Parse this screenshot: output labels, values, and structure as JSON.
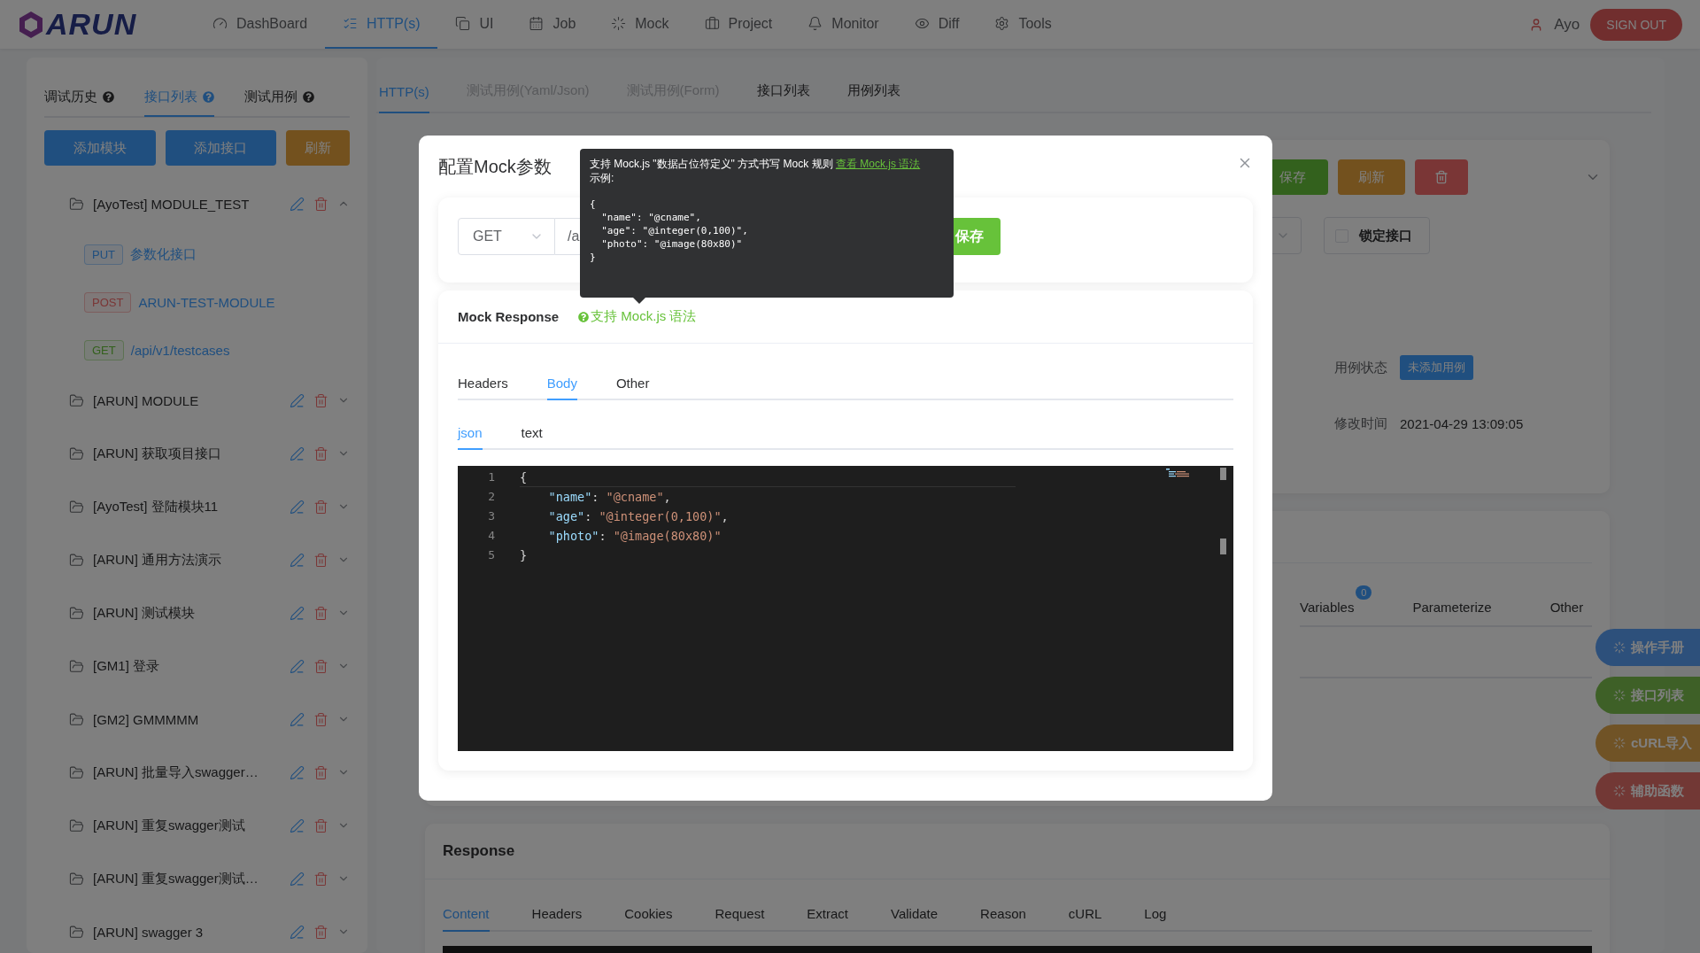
{
  "nav": {
    "logo": "ARUN",
    "items": [
      {
        "label": "DashBoard",
        "selected": false
      },
      {
        "label": "HTTP(s)",
        "selected": true
      },
      {
        "label": "UI",
        "selected": false
      },
      {
        "label": "Job",
        "selected": false
      },
      {
        "label": "Mock",
        "selected": false
      },
      {
        "label": "Project",
        "selected": false
      },
      {
        "label": "Monitor",
        "selected": false
      },
      {
        "label": "Diff",
        "selected": false
      },
      {
        "label": "Tools",
        "selected": false
      }
    ],
    "user": "Ayo",
    "sign_out": "SIGN OUT"
  },
  "sidebar": {
    "tabs": [
      {
        "label": "调试历史",
        "selected": false,
        "help": true
      },
      {
        "label": "接口列表",
        "selected": true,
        "help": true
      },
      {
        "label": "测试用例",
        "selected": false,
        "help": true
      }
    ],
    "buttons": [
      {
        "label": "添加模块",
        "kind": "primary"
      },
      {
        "label": "添加接口",
        "kind": "primary"
      },
      {
        "label": "刷新",
        "kind": "warning"
      }
    ],
    "modules": [
      {
        "name": "[AyoTest] MODULE_TEST",
        "expanded": true,
        "children": [
          {
            "method": "PUT",
            "kind": "primary",
            "name": "参数化接口"
          },
          {
            "method": "POST",
            "kind": "danger",
            "name": "ARUN-TEST-MODULE"
          },
          {
            "method": "GET",
            "kind": "success",
            "name": "/api/v1/testcases"
          }
        ]
      },
      {
        "name": "[ARUN] MODULE",
        "expanded": false
      },
      {
        "name": "[ARUN] 获取项目接口",
        "expanded": false
      },
      {
        "name": "[AyoTest] 登陆模块11",
        "expanded": false
      },
      {
        "name": "[ARUN] 通用方法演示",
        "expanded": false
      },
      {
        "name": "[ARUN] 测试模块",
        "expanded": false
      },
      {
        "name": "[GM1] 登录",
        "expanded": false
      },
      {
        "name": "[GM2] GMMMMM",
        "expanded": false
      },
      {
        "name": "[ARUN] 批量导入swagger…",
        "expanded": false
      },
      {
        "name": "[ARUN] 重复swagger测试",
        "expanded": false
      },
      {
        "name": "[ARUN] 重复swagger测试…",
        "expanded": false
      },
      {
        "name": "[ARUN] swagger 3",
        "expanded": false
      }
    ]
  },
  "main": {
    "tabs": [
      {
        "label": "HTTP(s)",
        "selected": true,
        "disabled": false
      },
      {
        "label": "测试用例(Yaml/Json)",
        "selected": false,
        "disabled": true
      },
      {
        "label": "测试用例(Form)",
        "selected": false,
        "disabled": true
      },
      {
        "label": "接口列表",
        "selected": false,
        "disabled": false
      },
      {
        "label": "用例列表",
        "selected": false,
        "disabled": false
      }
    ],
    "toolbar": [
      {
        "label": "保存",
        "kind": "success"
      },
      {
        "label": "刷新",
        "kind": "warning"
      },
      {
        "kind": "danger"
      }
    ],
    "lock": {
      "label": "锁定接口",
      "checked": false
    },
    "fields": [
      {
        "label": "用例状态",
        "value": "未添加用例",
        "kind": "tag"
      },
      {
        "label": "修改时间",
        "value": "2021-04-29 13:09:05",
        "kind": "text"
      }
    ],
    "config_tabs": [
      {
        "label": "Variables",
        "badge": "0",
        "selected": false
      },
      {
        "label": "Parameterize",
        "selected": false
      },
      {
        "label": "Other",
        "selected": false
      }
    ],
    "response": {
      "title": "Response",
      "tabs": [
        {
          "label": "Content",
          "selected": true
        },
        {
          "label": "Headers",
          "selected": false
        },
        {
          "label": "Cookies",
          "selected": false
        },
        {
          "label": "Request",
          "selected": false
        },
        {
          "label": "Extract",
          "selected": false
        },
        {
          "label": "Validate",
          "selected": false
        },
        {
          "label": "Reason",
          "selected": false
        },
        {
          "label": "cURL",
          "selected": false
        },
        {
          "label": "Log",
          "selected": false
        }
      ]
    }
  },
  "float_buttons": [
    {
      "label": "操作手册",
      "kind": "primary"
    },
    {
      "label": "接口列表",
      "kind": "success"
    },
    {
      "label": "cURL导入",
      "kind": "warning"
    },
    {
      "label": "辅助函数",
      "kind": "danger"
    }
  ],
  "modal": {
    "title": "配置Mock参数",
    "method": "GET",
    "url": "/a",
    "save": "保存",
    "response_title": "Mock Response",
    "hint": "支持 Mock.js 语法",
    "tabs": [
      {
        "label": "Headers",
        "selected": false
      },
      {
        "label": "Body",
        "selected": true
      },
      {
        "label": "Other",
        "selected": false
      }
    ],
    "body_tabs": [
      {
        "label": "json",
        "selected": true
      },
      {
        "label": "text",
        "selected": false
      }
    ],
    "code": [
      {
        "number": "1",
        "text": "{"
      },
      {
        "number": "2",
        "text": "    \"name\": \"@cname\","
      },
      {
        "number": "3",
        "text": "    \"age\": \"@integer(0,100)\","
      },
      {
        "number": "4",
        "text": "    \"photo\": \"@image(80x80)\""
      },
      {
        "number": "5",
        "text": "}"
      }
    ]
  },
  "tooltip": {
    "text": "支持 Mock.js \"数据占位符定义\" 方式书写 Mock 规则",
    "link": "查看 Mock.js 语法",
    "example_label": "示例:",
    "example": [
      "{",
      "  \"name\": \"@cname\",",
      "  \"age\": \"@integer(0,100)\",",
      "  \"photo\": \"@image(80x80)\"",
      "}"
    ]
  }
}
